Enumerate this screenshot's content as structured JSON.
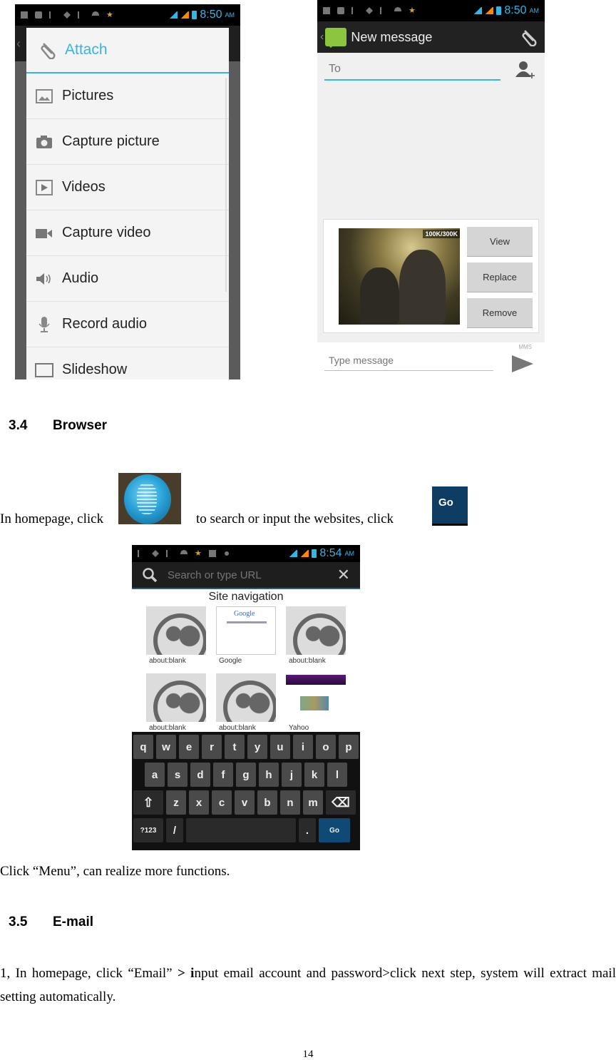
{
  "screenshot_attach": {
    "status_time": "8:50",
    "status_ampm": "AM",
    "dialog_title": "Attach",
    "items": [
      {
        "label": "Pictures",
        "icon": "picture-icon"
      },
      {
        "label": "Capture picture",
        "icon": "camera-icon"
      },
      {
        "label": "Videos",
        "icon": "video-icon"
      },
      {
        "label": "Capture video",
        "icon": "video-camera-icon"
      },
      {
        "label": "Audio",
        "icon": "speaker-icon"
      },
      {
        "label": "Record audio",
        "icon": "microphone-icon"
      },
      {
        "label": "Slideshow",
        "icon": "slideshow-icon"
      }
    ]
  },
  "screenshot_message": {
    "status_time": "8:50",
    "status_ampm": "AM",
    "title": "New message",
    "to_placeholder": "To",
    "attachment_size": "100K/300K",
    "buttons": {
      "view": "View",
      "replace": "Replace",
      "remove": "Remove"
    },
    "compose_placeholder": "Type message",
    "mms_label": "MMS"
  },
  "section_browser": {
    "number": "3.4",
    "title": "Browser",
    "instruction_part1": "In homepage, click",
    "instruction_part2": "to search or input the websites, click",
    "go_icon_label": "Go"
  },
  "screenshot_browser": {
    "status_time": "8:54",
    "status_ampm": "AM",
    "url_placeholder": "Search or type URL",
    "nav_title": "Site navigation",
    "tiles": [
      {
        "label": "about:blank",
        "type": "blank"
      },
      {
        "label": "Google",
        "type": "google"
      },
      {
        "label": "about:blank",
        "type": "blank"
      },
      {
        "label": "about:blank",
        "type": "blank"
      },
      {
        "label": "about:blank",
        "type": "blank"
      },
      {
        "label": "Yahoo",
        "type": "yahoo"
      }
    ],
    "google_logo": "Google",
    "keyboard": {
      "row1": [
        "q",
        "w",
        "e",
        "r",
        "t",
        "y",
        "u",
        "i",
        "o",
        "p"
      ],
      "row2": [
        "a",
        "s",
        "d",
        "f",
        "g",
        "h",
        "j",
        "k",
        "l"
      ],
      "row3": [
        "z",
        "x",
        "c",
        "v",
        "b",
        "n",
        "m"
      ],
      "shift": "⇧",
      "backspace": "⌫",
      "symbols": "?123",
      "slash": "/",
      "period": ".",
      "go": "Go"
    }
  },
  "menu_note": "Click “Menu”, can realize more functions.",
  "section_email": {
    "number": "3.5",
    "title": "E-mail",
    "para_a": "1, In homepage, click “Email” ",
    "para_bold1": "> i",
    "para_b": "nput email account and password>click next step, system will extract mail setting automatically."
  },
  "page_number": "14"
}
